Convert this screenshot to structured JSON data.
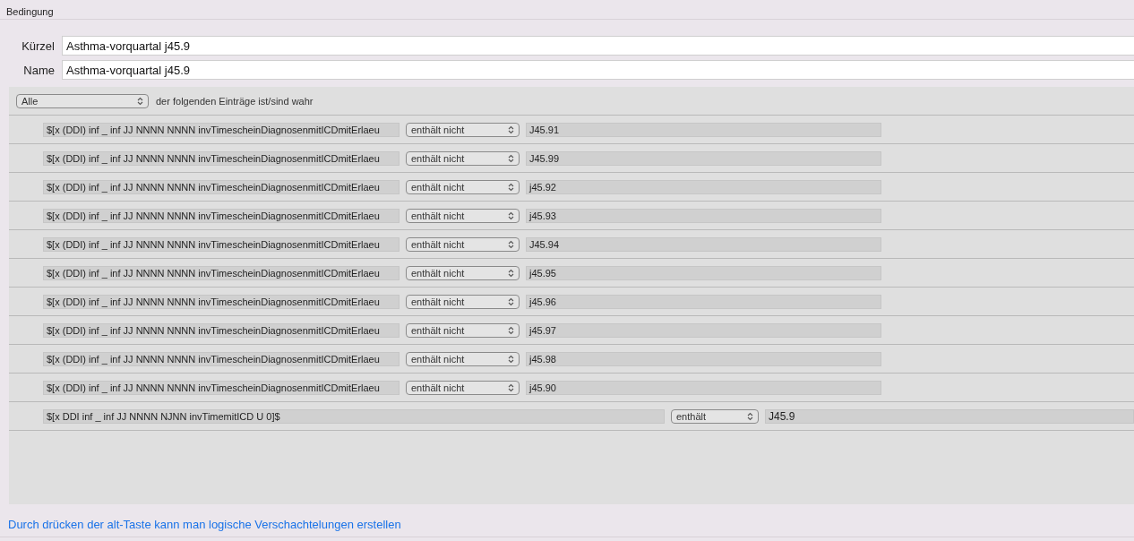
{
  "section_title": "Bedingung",
  "fields": [
    {
      "label": "Kürzel",
      "value": "Asthma-vorquartal j45.9"
    },
    {
      "label": "Name",
      "value": "Asthma-vorquartal j45.9"
    }
  ],
  "match": {
    "selector": "Alle",
    "text": "der folgenden Einträge ist/sind wahr"
  },
  "conditions": [
    {
      "kind": "standard",
      "variable": "$[x (DDI) inf _ inf JJ NNNN NNNN invTimescheinDiagnosenmitICDmitErlaeu",
      "operator": "enthält nicht",
      "value": "J45.91"
    },
    {
      "kind": "standard",
      "variable": "$[x (DDI) inf _ inf JJ NNNN NNNN invTimescheinDiagnosenmitICDmitErlaeu",
      "operator": "enthält nicht",
      "value": "J45.99"
    },
    {
      "kind": "standard",
      "variable": "$[x (DDI) inf _ inf JJ NNNN NNNN invTimescheinDiagnosenmitICDmitErlaeu",
      "operator": "enthält nicht",
      "value": "j45.92"
    },
    {
      "kind": "standard",
      "variable": "$[x (DDI) inf _ inf JJ NNNN NNNN invTimescheinDiagnosenmitICDmitErlaeu",
      "operator": "enthält nicht",
      "value": "j45.93"
    },
    {
      "kind": "standard",
      "variable": "$[x (DDI) inf _ inf JJ NNNN NNNN invTimescheinDiagnosenmitICDmitErlaeu",
      "operator": "enthält nicht",
      "value": "J45.94"
    },
    {
      "kind": "standard",
      "variable": "$[x (DDI) inf _ inf JJ NNNN NNNN invTimescheinDiagnosenmitICDmitErlaeu",
      "operator": "enthält nicht",
      "value": "j45.95"
    },
    {
      "kind": "standard",
      "variable": "$[x (DDI) inf _ inf JJ NNNN NNNN invTimescheinDiagnosenmitICDmitErlaeu",
      "operator": "enthält nicht",
      "value": "j45.96"
    },
    {
      "kind": "standard",
      "variable": "$[x (DDI) inf _ inf JJ NNNN NNNN invTimescheinDiagnosenmitICDmitErlaeu",
      "operator": "enthält nicht",
      "value": "j45.97"
    },
    {
      "kind": "standard",
      "variable": "$[x (DDI) inf _ inf JJ NNNN NNNN invTimescheinDiagnosenmitICDmitErlaeu",
      "operator": "enthält nicht",
      "value": "j45.98"
    },
    {
      "kind": "standard",
      "variable": "$[x (DDI) inf _ inf JJ NNNN NNNN invTimescheinDiagnosenmitICDmitErlaeu",
      "operator": "enthält nicht",
      "value": "j45.90"
    },
    {
      "kind": "wide",
      "variable": "$[x DDI inf _ inf JJ NNNN NJNN invTimemitICD U 0]$",
      "operator": "enthält",
      "value": "J45.9"
    }
  ],
  "hint_link": "Durch drücken der alt-Taste kann man logische Verschachtelungen erstellen"
}
